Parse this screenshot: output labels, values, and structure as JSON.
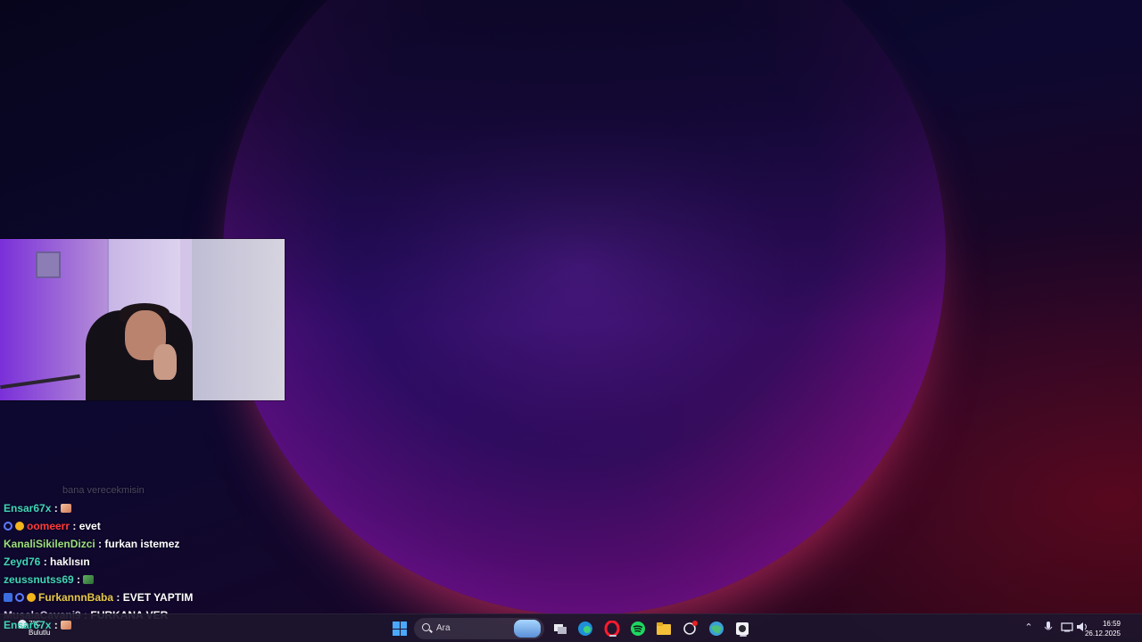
{
  "stream_overlay": {
    "chat": {
      "faded_line": "bana verecekmisin",
      "messages": [
        {
          "user": "Ensar67x",
          "user_color": "#3fd6b8",
          "separator": " : ",
          "text": "",
          "emote": "hand-emote",
          "badges": []
        },
        {
          "user": "oomeerr",
          "user_color": "#ff3b3b",
          "separator": " : ",
          "text": "evet",
          "emote": "",
          "badges": [
            "ring-badge",
            "gold-badge"
          ]
        },
        {
          "user": "KanaliSikilenDizci",
          "user_color": "#9be07a",
          "separator": " : ",
          "text": "furkan istemez",
          "emote": "",
          "badges": []
        },
        {
          "user": "Zeyd76",
          "user_color": "#3fd6b8",
          "separator": " : ",
          "text": "haklısın",
          "emote": "",
          "badges": []
        },
        {
          "user": "zeussnutss69",
          "user_color": "#3fd6b8",
          "separator": " : ",
          "text": "",
          "emote": "frog-emote",
          "badges": []
        },
        {
          "user": "FurkannnBaba",
          "user_color": "#e6c84a",
          "separator": " : ",
          "text": "EVET YAPTIM",
          "emote": "",
          "badges": [
            "blue-badge",
            "ring-badge",
            "gold-badge"
          ]
        },
        {
          "user": "MusalaCavani9",
          "user_color": "#c9c6e0",
          "separator": " : ",
          "text": "FURKANA VER",
          "emote": "",
          "badges": []
        },
        {
          "user": "Ensar67x",
          "user_color": "#3fd6b8",
          "separator": " : ",
          "text": "",
          "emote": "hand-emote",
          "badges": []
        }
      ]
    }
  },
  "taskbar": {
    "weather": {
      "temp": "7°C",
      "condition": "Bulutlu"
    },
    "search": {
      "placeholder": "Ara"
    },
    "apps": [
      {
        "name": "start-icon"
      },
      {
        "name": "task-view-icon"
      },
      {
        "name": "edge-icon"
      },
      {
        "name": "opera-icon"
      },
      {
        "name": "spotify-icon"
      },
      {
        "name": "file-explorer-icon"
      },
      {
        "name": "chatgpt-icon"
      },
      {
        "name": "browser-icon"
      },
      {
        "name": "obs-icon"
      }
    ],
    "clock": {
      "time": "16:59",
      "date": "26.12.2025"
    }
  },
  "colors": {
    "taskbar_bg": "#1c162c",
    "accent": "#4aa8ff"
  }
}
